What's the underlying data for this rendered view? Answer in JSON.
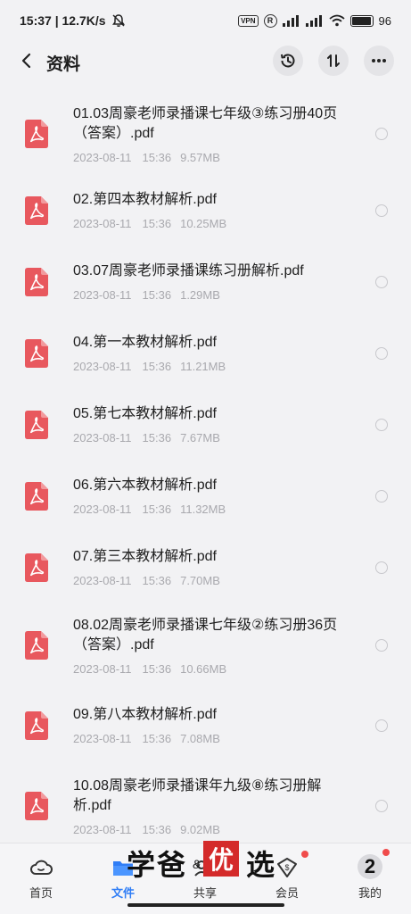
{
  "status_bar": {
    "time_speed": "15:37 | 12.7K/s",
    "vpn": "VPN",
    "r_badge": "R",
    "battery_percent": "96",
    "battery_level": 0.96
  },
  "header": {
    "title": "资料"
  },
  "files": [
    {
      "name": "01.03周豪老师录播课七年级③练习册40页（答案）.pdf",
      "date": "2023-08-11",
      "time": "15:36",
      "size": "9.57MB"
    },
    {
      "name": "02.第四本教材解析.pdf",
      "date": "2023-08-11",
      "time": "15:36",
      "size": "10.25MB"
    },
    {
      "name": "03.07周豪老师录播课练习册解析.pdf",
      "date": "2023-08-11",
      "time": "15:36",
      "size": "1.29MB"
    },
    {
      "name": "04.第一本教材解析.pdf",
      "date": "2023-08-11",
      "time": "15:36",
      "size": "11.21MB"
    },
    {
      "name": "05.第七本教材解析.pdf",
      "date": "2023-08-11",
      "time": "15:36",
      "size": "7.67MB"
    },
    {
      "name": "06.第六本教材解析.pdf",
      "date": "2023-08-11",
      "time": "15:36",
      "size": "11.32MB"
    },
    {
      "name": "07.第三本教材解析.pdf",
      "date": "2023-08-11",
      "time": "15:36",
      "size": "7.70MB"
    },
    {
      "name": "08.02周豪老师录播课七年级②练习册36页（答案）.pdf",
      "date": "2023-08-11",
      "time": "15:36",
      "size": "10.66MB"
    },
    {
      "name": "09.第八本教材解析.pdf",
      "date": "2023-08-11",
      "time": "15:36",
      "size": "7.08MB"
    },
    {
      "name": "10.08周豪老师录播课年九级⑧练习册解析.pdf",
      "date": "2023-08-11",
      "time": "15:36",
      "size": "9.02MB"
    }
  ],
  "bottom_nav": {
    "items": [
      {
        "label": "首页",
        "icon": "cloud-icon"
      },
      {
        "label": "文件",
        "icon": "folder-icon",
        "active": true
      },
      {
        "label": "共享",
        "icon": "share-icon"
      },
      {
        "label": "会员",
        "icon": "vip-icon"
      },
      {
        "label": "我的",
        "icon": "avatar-icon"
      }
    ],
    "avatar_text": "2"
  },
  "watermark": {
    "text_left": "学爸",
    "text_mid": "优",
    "text_right": "选",
    "amp": "&"
  },
  "colors": {
    "accent": "#2f7df6",
    "pdf_red": "#e8585e",
    "badge_red": "#f04b4b"
  }
}
